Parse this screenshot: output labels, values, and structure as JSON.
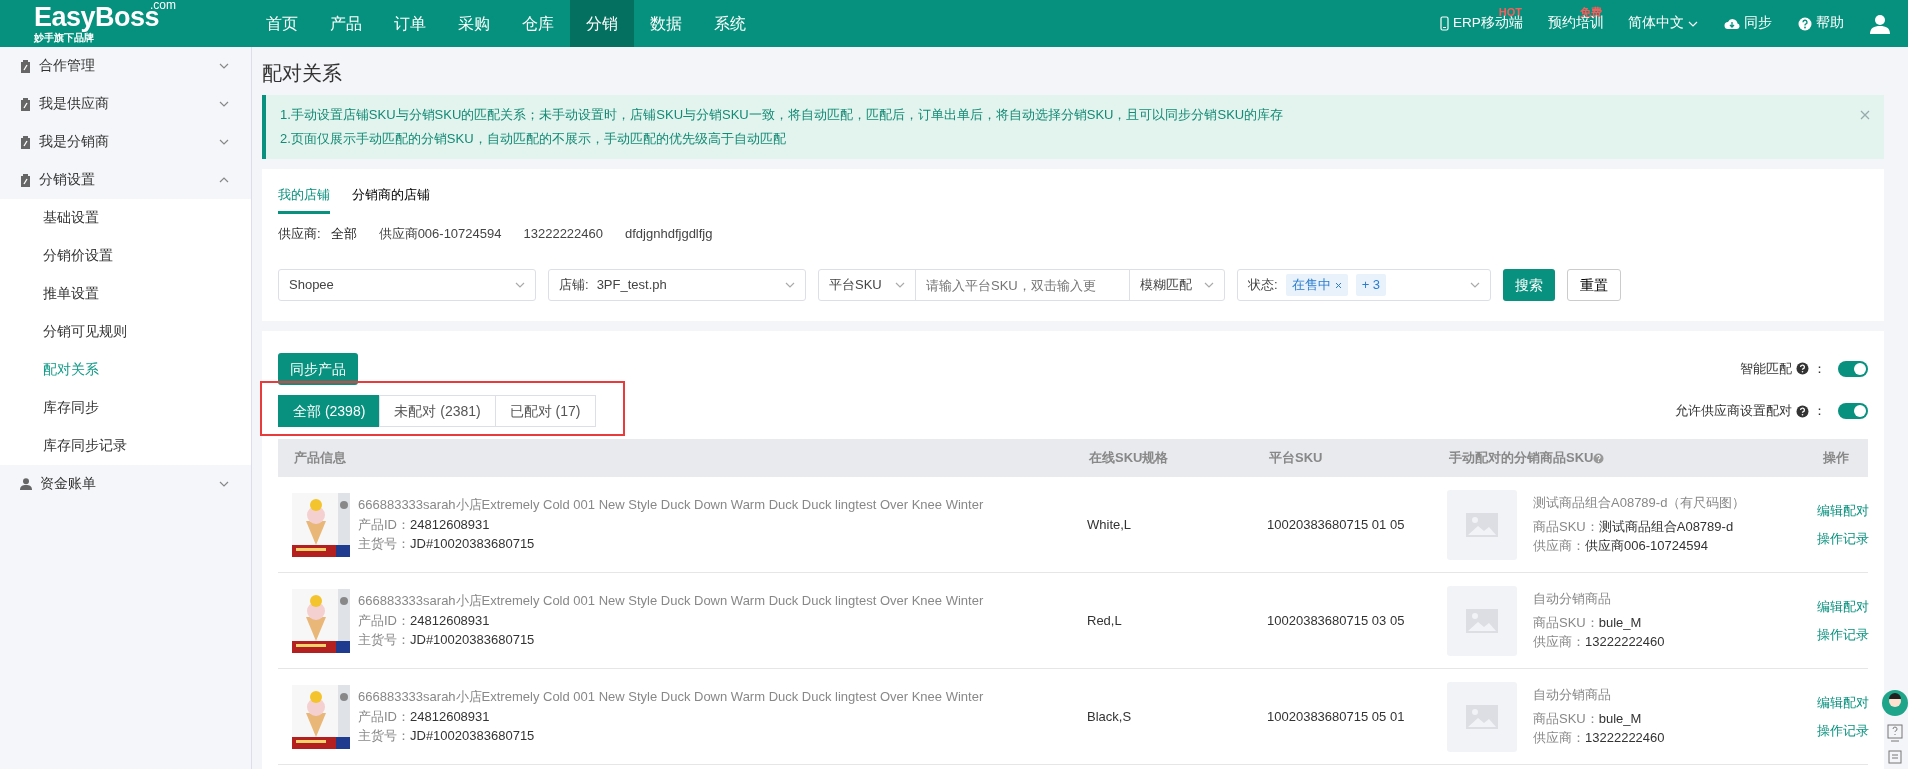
{
  "brand": {
    "logo": "EasyBoss",
    "logo_suffix": ".com",
    "tagline": "妙手旗下品牌"
  },
  "nav": [
    {
      "label": "首页",
      "selected": false
    },
    {
      "label": "产品",
      "selected": false
    },
    {
      "label": "订单",
      "selected": false
    },
    {
      "label": "采购",
      "selected": false
    },
    {
      "label": "仓库",
      "selected": false
    },
    {
      "label": "分销",
      "selected": true
    },
    {
      "label": "数据",
      "selected": false
    },
    {
      "label": "系统",
      "selected": false
    }
  ],
  "top_links": [
    {
      "kind": "phone",
      "label": "ERP移动端",
      "badge": "HOT"
    },
    {
      "kind": "plain",
      "label": "预约培训",
      "badge": "免费"
    },
    {
      "kind": "dropdown",
      "label": "简体中文"
    },
    {
      "kind": "cloud",
      "label": "同步"
    },
    {
      "kind": "help",
      "label": "帮助"
    }
  ],
  "sidebar": [
    {
      "label": "合作管理",
      "kind": "clipboard",
      "expanded": false
    },
    {
      "label": "我是供应商",
      "kind": "clipboard",
      "expanded": false
    },
    {
      "label": "我是分销商",
      "kind": "clipboard",
      "expanded": false
    },
    {
      "label": "分销设置",
      "kind": "clipboard",
      "expanded": true,
      "children": [
        {
          "label": "基础设置",
          "selected": false
        },
        {
          "label": "分销价设置",
          "selected": false
        },
        {
          "label": "推单设置",
          "selected": false
        },
        {
          "label": "分销可见规则",
          "selected": false
        },
        {
          "label": "配对关系",
          "selected": true
        },
        {
          "label": "库存同步",
          "selected": false
        },
        {
          "label": "库存同步记录",
          "selected": false
        }
      ]
    },
    {
      "label": "资金账单",
      "kind": "person",
      "expanded": false
    }
  ],
  "page_title": "配对关系",
  "notice": [
    "1.手动设置店铺SKU与分销SKU的匹配关系；未手动设置时，店铺SKU与分销SKU一致，将自动匹配，匹配后，订单出单后，将自动选择分销SKU，且可以同步分销SKU的库存",
    "2.页面仅展示手动匹配的分销SKU，自动匹配的不展示，手动匹配的优先级高于自动匹配"
  ],
  "store_tabs": [
    {
      "label": "我的店铺",
      "selected": true
    },
    {
      "label": "分销商的店铺",
      "selected": false
    }
  ],
  "suppliers": {
    "label": "供应商:",
    "items": [
      {
        "label": "全部",
        "selected": true
      },
      {
        "label": "供应商006-10724594",
        "selected": false
      },
      {
        "label": "13222222460",
        "selected": false
      },
      {
        "label": "dfdjgnhdfjgdlfjg",
        "selected": false
      }
    ]
  },
  "filters": {
    "platform": "Shopee",
    "store_label": "店铺:",
    "store": "3PF_test.ph",
    "sku_type": "平台SKU",
    "sku_placeholder": "请输入平台SKU，双击输入更",
    "match": "模糊匹配",
    "status_label": "状态:",
    "status_tags": [
      "在售中"
    ],
    "status_more": "+ 3",
    "search": "搜索",
    "reset": "重置"
  },
  "sync_button": "同步产品",
  "toggles": [
    {
      "label": "智能匹配",
      "suffix": "：",
      "on": true
    },
    {
      "label": "允许供应商设置配对",
      "suffix": "：",
      "on": true
    }
  ],
  "count_tabs": [
    {
      "label": "全部 (2398)",
      "selected": true
    },
    {
      "label": "未配对 (2381)",
      "selected": false
    },
    {
      "label": "已配对 (17)",
      "selected": false
    }
  ],
  "table": {
    "columns": [
      "产品信息",
      "在线SKU规格",
      "平台SKU",
      "手动配对的分销商品SKU",
      "操作"
    ],
    "rows": [
      {
        "title": "666883333sarah小店Extremely Cold 001 New Style Duck Down Warm Duck Duck lingtest Over Knee Winter",
        "id_label": "产品ID：",
        "id": "24812608931",
        "code_label": "主货号：",
        "code": "JD#10020383680715",
        "spec": "White,L",
        "platform_sku": "10020383680715 01 05",
        "match": {
          "name": "测试商品组合A08789-d（有尺码图）",
          "sku_label": "商品SKU：",
          "sku": "测试商品组合A08789-d",
          "supplier_label": "供应商：",
          "supplier": "供应商006-10724594"
        },
        "actions": [
          "编辑配对",
          "操作记录"
        ]
      },
      {
        "title": "666883333sarah小店Extremely Cold 001 New Style Duck Down Warm Duck Duck lingtest Over Knee Winter",
        "id_label": "产品ID：",
        "id": "24812608931",
        "code_label": "主货号：",
        "code": "JD#10020383680715",
        "spec": "Red,L",
        "platform_sku": "10020383680715 03 05",
        "match": {
          "name": "自动分销商品",
          "sku_label": "商品SKU：",
          "sku": "bule_M",
          "supplier_label": "供应商：",
          "supplier": "13222222460"
        },
        "actions": [
          "编辑配对",
          "操作记录"
        ]
      },
      {
        "title": "666883333sarah小店Extremely Cold 001 New Style Duck Down Warm Duck Duck lingtest Over Knee Winter",
        "id_label": "产品ID：",
        "id": "24812608931",
        "code_label": "主货号：",
        "code": "JD#10020383680715",
        "spec": "Black,S",
        "platform_sku": "10020383680715 05 01",
        "match": {
          "name": "自动分销商品",
          "sku_label": "商品SKU：",
          "sku": "bule_M",
          "supplier_label": "供应商：",
          "supplier": "13222222460"
        },
        "actions": [
          "编辑配对",
          "操作记录"
        ]
      }
    ]
  }
}
